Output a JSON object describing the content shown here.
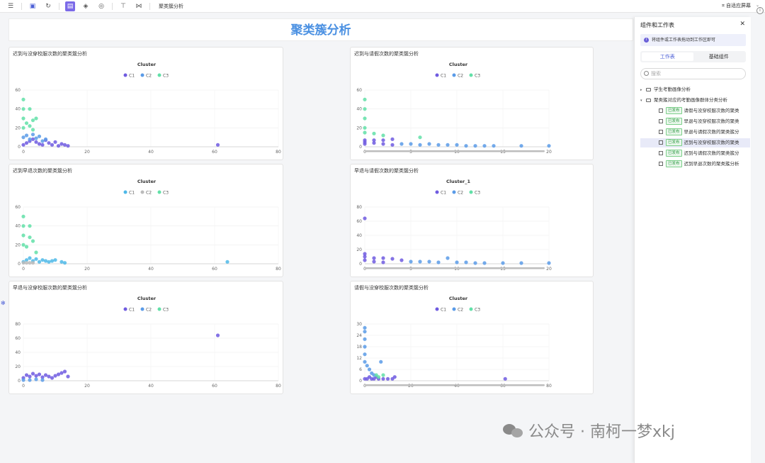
{
  "toolbar": {
    "doc_title": "聚类簇分析",
    "fit_label": "自适应屏幕"
  },
  "dashboard_title": "聚类簇分析",
  "colors": {
    "c1": "#6f5be0",
    "c2": "#5a9be8",
    "c3": "#62e0a8",
    "c1_alt": "#4db8e8",
    "c2_alt": "#bbbbbb"
  },
  "panels": [
    {
      "title": "迟到与没穿校服次数的聚类簇分析",
      "legend_title": "Cluster",
      "legend": [
        "C1",
        "C2",
        "C3"
      ]
    },
    {
      "title": "迟到与请假次数的聚类簇分析",
      "legend_title": "Cluster",
      "legend": [
        "C1",
        "C2",
        "C3"
      ]
    },
    {
      "title": "迟到早退次数的聚类簇分析",
      "legend_title": "Cluster",
      "legend": [
        "C1",
        "C2",
        "C3"
      ]
    },
    {
      "title": "早退与请假次数的聚类簇分析",
      "legend_title": "Cluster_1",
      "legend": [
        "C1",
        "C2",
        "C3"
      ]
    },
    {
      "title": "早退与没穿校服次数的聚类簇分析",
      "legend_title": "Cluster",
      "legend": [
        "C1",
        "C2",
        "C3"
      ]
    },
    {
      "title": "请假与没穿校服次数的聚类簇分析",
      "legend_title": "Cluster",
      "legend": [
        "C1",
        "C2",
        "C3"
      ]
    }
  ],
  "chart_data": [
    {
      "type": "scatter",
      "xlim": [
        0,
        80
      ],
      "ylim": [
        0,
        60
      ],
      "xticks": [
        0,
        20,
        40,
        60,
        80
      ],
      "yticks": [
        0,
        20,
        40,
        60
      ],
      "series": [
        {
          "name": "C1",
          "points": [
            [
              0,
              2
            ],
            [
              1,
              4
            ],
            [
              2,
              6
            ],
            [
              3,
              8
            ],
            [
              4,
              5
            ],
            [
              5,
              3
            ],
            [
              6,
              2
            ],
            [
              7,
              7
            ],
            [
              8,
              4
            ],
            [
              9,
              2
            ],
            [
              10,
              5
            ],
            [
              11,
              1
            ],
            [
              12,
              3
            ],
            [
              13,
              2
            ],
            [
              14,
              1
            ],
            [
              61,
              2
            ]
          ]
        },
        {
          "name": "C2",
          "points": [
            [
              0,
              10
            ],
            [
              1,
              12
            ],
            [
              2,
              8
            ],
            [
              3,
              13
            ],
            [
              4,
              9
            ],
            [
              5,
              11
            ],
            [
              6,
              6
            ],
            [
              7,
              8
            ]
          ]
        },
        {
          "name": "C3",
          "points": [
            [
              0,
              50
            ],
            [
              0,
              40
            ],
            [
              2,
              40
            ],
            [
              0,
              30
            ],
            [
              1,
              25
            ],
            [
              3,
              28
            ],
            [
              4,
              30
            ],
            [
              0,
              20
            ],
            [
              2,
              22
            ],
            [
              3,
              18
            ]
          ]
        }
      ]
    },
    {
      "type": "scatter",
      "xlim": [
        0,
        20
      ],
      "ylim": [
        0,
        60
      ],
      "xticks": [
        0,
        5,
        10,
        15,
        20
      ],
      "yticks": [
        0,
        20,
        40,
        60
      ],
      "series": [
        {
          "name": "C1",
          "points": [
            [
              0,
              3
            ],
            [
              0,
              5
            ],
            [
              0,
              7
            ],
            [
              1,
              7
            ],
            [
              2,
              7
            ],
            [
              3,
              8
            ],
            [
              1,
              4
            ],
            [
              2,
              3
            ],
            [
              3,
              2
            ]
          ]
        },
        {
          "name": "C2",
          "points": [
            [
              4,
              3
            ],
            [
              5,
              3
            ],
            [
              6,
              2
            ],
            [
              7,
              3
            ],
            [
              8,
              2
            ],
            [
              9,
              2
            ],
            [
              10,
              2
            ],
            [
              11,
              1
            ],
            [
              12,
              1
            ],
            [
              13,
              1
            ],
            [
              14,
              1
            ],
            [
              17,
              1
            ],
            [
              20,
              1
            ]
          ]
        },
        {
          "name": "C3",
          "points": [
            [
              0,
              50
            ],
            [
              0,
              40
            ],
            [
              0,
              30
            ],
            [
              0,
              20
            ],
            [
              0,
              15
            ],
            [
              1,
              14
            ],
            [
              2,
              12
            ],
            [
              6,
              10
            ]
          ]
        }
      ]
    },
    {
      "type": "scatter",
      "xlim": [
        0,
        80
      ],
      "ylim": [
        0,
        60
      ],
      "xticks": [
        0,
        20,
        40,
        60,
        80
      ],
      "yticks": [
        0,
        20,
        40,
        60
      ],
      "series": [
        {
          "name": "C1",
          "points": [
            [
              0,
              2
            ],
            [
              1,
              4
            ],
            [
              2,
              6
            ],
            [
              3,
              3
            ],
            [
              4,
              5
            ],
            [
              5,
              2
            ],
            [
              6,
              4
            ],
            [
              7,
              3
            ],
            [
              8,
              2
            ],
            [
              9,
              3
            ],
            [
              10,
              4
            ],
            [
              12,
              2
            ],
            [
              13,
              1
            ],
            [
              64,
              2
            ]
          ]
        },
        {
          "name": "C2",
          "points": [
            [
              0,
              1
            ],
            [
              1,
              1
            ],
            [
              2,
              1
            ],
            [
              3,
              1
            ]
          ]
        },
        {
          "name": "C3",
          "points": [
            [
              0,
              50
            ],
            [
              0,
              40
            ],
            [
              2,
              40
            ],
            [
              0,
              30
            ],
            [
              2,
              28
            ],
            [
              3,
              24
            ],
            [
              0,
              20
            ],
            [
              1,
              18
            ],
            [
              4,
              12
            ]
          ]
        }
      ]
    },
    {
      "type": "scatter",
      "xlim": [
        0,
        20
      ],
      "ylim": [
        0,
        80
      ],
      "xticks": [
        0,
        5,
        10,
        15,
        20
      ],
      "yticks": [
        0,
        20,
        40,
        60,
        80
      ],
      "series": [
        {
          "name": "C1",
          "points": [
            [
              0,
              64
            ],
            [
              0,
              14
            ],
            [
              0,
              10
            ],
            [
              0,
              5
            ],
            [
              1,
              8
            ],
            [
              2,
              8
            ],
            [
              3,
              7
            ],
            [
              4,
              5
            ],
            [
              1,
              3
            ],
            [
              2,
              2
            ]
          ]
        },
        {
          "name": "C2",
          "points": [
            [
              5,
              3
            ],
            [
              6,
              3
            ],
            [
              7,
              3
            ],
            [
              8,
              2
            ],
            [
              9,
              8
            ],
            [
              10,
              2
            ],
            [
              11,
              2
            ],
            [
              12,
              1
            ],
            [
              13,
              1
            ],
            [
              15,
              1
            ],
            [
              17,
              1
            ],
            [
              20,
              1
            ]
          ]
        },
        {
          "name": "C3",
          "points": []
        }
      ]
    },
    {
      "type": "scatter",
      "xlim": [
        0,
        80
      ],
      "ylim": [
        0,
        80
      ],
      "xticks": [
        0,
        20,
        40,
        60,
        80
      ],
      "yticks": [
        0,
        20,
        40,
        60,
        80
      ],
      "series": [
        {
          "name": "C1",
          "points": [
            [
              0,
              4
            ],
            [
              1,
              8
            ],
            [
              2,
              6
            ],
            [
              3,
              10
            ],
            [
              4,
              7
            ],
            [
              5,
              9
            ],
            [
              6,
              5
            ],
            [
              7,
              8
            ],
            [
              8,
              6
            ],
            [
              9,
              4
            ],
            [
              10,
              7
            ],
            [
              11,
              9
            ],
            [
              12,
              11
            ],
            [
              13,
              13
            ],
            [
              14,
              6
            ],
            [
              61,
              64
            ]
          ]
        },
        {
          "name": "C2",
          "points": [
            [
              0,
              1
            ],
            [
              2,
              1
            ],
            [
              4,
              2
            ],
            [
              6,
              1
            ]
          ]
        },
        {
          "name": "C3",
          "points": []
        }
      ]
    },
    {
      "type": "scatter",
      "xlim": [
        0,
        80
      ],
      "ylim": [
        0,
        30
      ],
      "xticks": [
        0,
        20,
        40,
        60,
        80
      ],
      "yticks": [
        0,
        6,
        12,
        18,
        24,
        30
      ],
      "series": [
        {
          "name": "C1",
          "points": [
            [
              0,
              1
            ],
            [
              1,
              1
            ],
            [
              2,
              2
            ],
            [
              3,
              1
            ],
            [
              4,
              1
            ],
            [
              5,
              2
            ],
            [
              6,
              1
            ],
            [
              8,
              1
            ],
            [
              10,
              1
            ],
            [
              12,
              1
            ],
            [
              13,
              2
            ],
            [
              61,
              1
            ]
          ]
        },
        {
          "name": "C2",
          "points": [
            [
              0,
              28
            ],
            [
              0,
              26
            ],
            [
              0,
              22
            ],
            [
              0,
              18
            ],
            [
              0,
              14
            ],
            [
              0,
              10
            ],
            [
              1,
              8
            ],
            [
              2,
              6
            ],
            [
              3,
              4
            ],
            [
              4,
              3
            ],
            [
              7,
              10
            ]
          ]
        },
        {
          "name": "C3",
          "points": [
            [
              5,
              3
            ],
            [
              6,
              2
            ],
            [
              8,
              3
            ]
          ]
        }
      ]
    }
  ],
  "right_panel": {
    "title": "组件和工作表",
    "tip": "将组件或工作表拖动到工作区即可",
    "tabs": [
      "工作表",
      "基础组件"
    ],
    "search_placeholder": "搜索",
    "folders": [
      "学生考勤画像分析",
      "聚类簇对应的考勤画像群体分类分析"
    ],
    "badge": "已发布",
    "items": [
      "请假与没穿校服次数的聚类",
      "早退与没穿校服次数的聚类",
      "早退与请假次数的聚类簇分",
      "迟到与没穿校服次数的聚类",
      "迟到与请假次数的聚类簇分",
      "迟到早退次数的聚类簇分析"
    ]
  },
  "watermark": "公众号 · 南柯一梦xkj"
}
